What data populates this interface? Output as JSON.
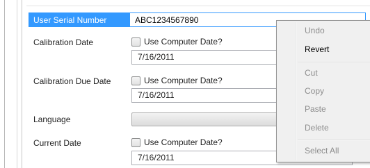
{
  "serial": {
    "label": "User Serial Number",
    "value": "ABC1234567890"
  },
  "calibration_date": {
    "label": "Calibration Date",
    "checkbox_label": "Use Computer Date?",
    "checked": false,
    "date": "7/16/2011"
  },
  "calibration_due_date": {
    "label": "Calibration Due Date",
    "checkbox_label": "Use Computer Date?",
    "checked": false,
    "date": "7/16/2011"
  },
  "language": {
    "label": "Language",
    "value": ""
  },
  "current_date": {
    "label": "Current Date",
    "checkbox_label": "Use Computer Date?",
    "checked": false,
    "date": "7/16/2011"
  },
  "context_menu": {
    "items": [
      {
        "label": "Undo",
        "enabled": false
      },
      {
        "label": "Revert",
        "enabled": true
      },
      {
        "label": "Cut",
        "enabled": false
      },
      {
        "label": "Copy",
        "enabled": false
      },
      {
        "label": "Paste",
        "enabled": false
      },
      {
        "label": "Delete",
        "enabled": false
      },
      {
        "label": "Select All",
        "enabled": false
      }
    ]
  },
  "colors": {
    "selection_bg": "#3399ff",
    "selection_text": "#ffffff",
    "menu_bg": "#f0f0f0",
    "disabled_text": "#8d8d8d"
  }
}
